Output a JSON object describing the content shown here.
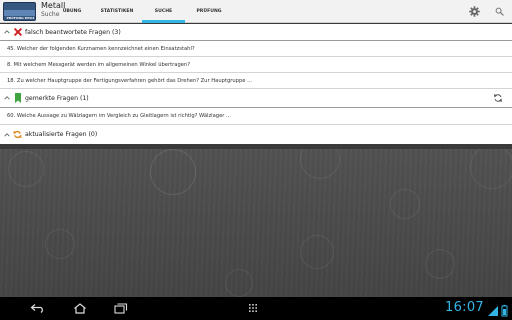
{
  "app": {
    "icon_label": "PRÜFUNG MTA2",
    "title": "Metall",
    "subtitle": "Suche"
  },
  "tabs": [
    {
      "label": "ÜBUNG",
      "active": false
    },
    {
      "label": "STATISTIKEN",
      "active": false
    },
    {
      "label": "SUCHE",
      "active": true
    },
    {
      "label": "PRÜFUNG",
      "active": false
    }
  ],
  "actionbar_icons": [
    "gear-icon",
    "search-icon"
  ],
  "sections": [
    {
      "label": "falsch beantwortete Fragen (3)",
      "icon": "red-x-icon",
      "items": [
        "45. Welcher der folgenden Kurznamen kennzeichnet einen Einsatzstahl?",
        "8. Mit welchem Messgerät werden im allgemeinen Winkel übertragen?",
        "18. Zu welcher Hauptgruppe der Fertigungsverfahren gehört das Drehen? Zur Hauptgruppe ..."
      ]
    },
    {
      "label": "gemerkte Fragen (1)",
      "icon": "green-bookmark-icon",
      "items": [
        "60. Welche Aussage zu Wälzlagern im Vergleich zu Gleitlagern ist richtig? Wälzlager ..."
      ]
    },
    {
      "label": "aktualisierte Fragen (0)",
      "icon": "orange-sync-icon",
      "items": []
    }
  ],
  "statusbar": {
    "time": "16:07",
    "nav": [
      "back-icon",
      "home-icon",
      "recent-apps-icon",
      "grid-icon"
    ]
  },
  "colors": {
    "accent": "#33b5e5",
    "red": "#cc1f1f",
    "green": "#3fa33f",
    "orange": "#e08a1e"
  }
}
